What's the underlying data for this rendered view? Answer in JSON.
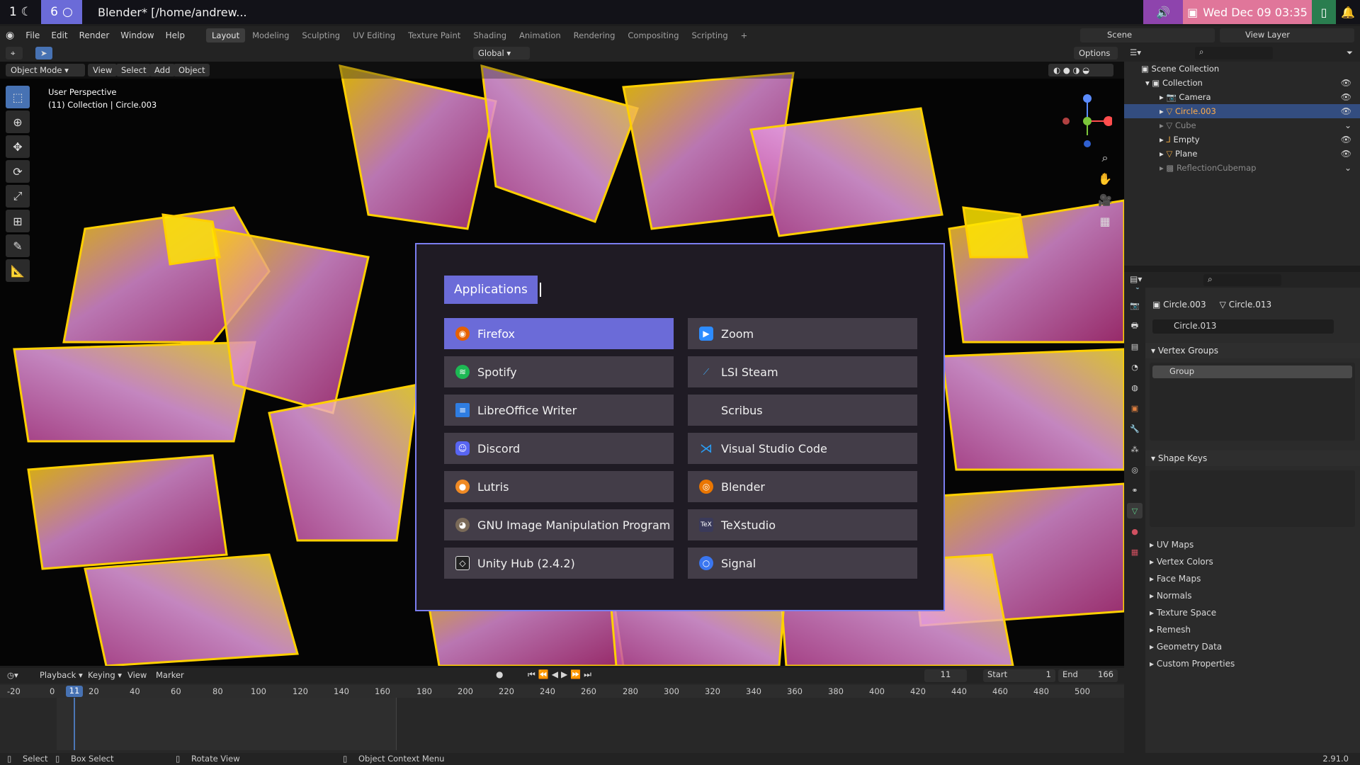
{
  "topbar": {
    "ws1": "1",
    "ws6": "6",
    "window_title": "Blender* [/home/andrew...",
    "clock": "Wed Dec 09 03:35"
  },
  "blender_menu": [
    "File",
    "Edit",
    "Render",
    "Window",
    "Help"
  ],
  "workspaces": [
    "Layout",
    "Modeling",
    "Sculpting",
    "UV Editing",
    "Texture Paint",
    "Shading",
    "Animation",
    "Rendering",
    "Compositing",
    "Scripting"
  ],
  "scene": "Scene",
  "view_layer": "View Layer",
  "viewport": {
    "mode": "Object Mode",
    "menus": [
      "View",
      "Select",
      "Add",
      "Object"
    ],
    "orientation": "Global",
    "options": "Options",
    "info_line1": "User Perspective",
    "info_line2": "(11) Collection | Circle.003"
  },
  "launcher": {
    "prompt": "Applications",
    "entries": [
      {
        "label": "Firefox",
        "icon": "firefox-icon",
        "color": "#e66000"
      },
      {
        "label": "Zoom",
        "icon": "zoom-icon",
        "color": "#2d8cff"
      },
      {
        "label": "Spotify",
        "icon": "spotify-icon",
        "color": "#1db954"
      },
      {
        "label": "LSI Steam",
        "icon": "steam-icon",
        "color": "#3fa9f5"
      },
      {
        "label": "LibreOffice Writer",
        "icon": "writer-icon",
        "color": "#2f7de1"
      },
      {
        "label": "Scribus",
        "icon": "scribus-icon",
        "color": "#433d48"
      },
      {
        "label": "Discord",
        "icon": "discord-icon",
        "color": "#5865f2"
      },
      {
        "label": "Visual Studio Code",
        "icon": "vscode-icon",
        "color": "#2a9df4"
      },
      {
        "label": "Lutris",
        "icon": "lutris-icon",
        "color": "#f08a24"
      },
      {
        "label": "Blender",
        "icon": "blender-icon",
        "color": "#ea7600"
      },
      {
        "label": "GNU Image Manipulation Program",
        "icon": "gimp-icon",
        "color": "#7a6a58"
      },
      {
        "label": "TeXstudio",
        "icon": "texstudio-icon",
        "color": "#3a3a5a"
      },
      {
        "label": "Unity Hub (2.4.2)",
        "icon": "unity-icon",
        "color": "#222"
      },
      {
        "label": "Signal",
        "icon": "signal-icon",
        "color": "#3a76f0"
      }
    ]
  },
  "outliner": {
    "scene_collection": "Scene Collection",
    "collection": "Collection",
    "items": [
      "Camera",
      "Circle.003",
      "Cube",
      "Empty",
      "Plane",
      "ReflectionCubemap"
    ]
  },
  "properties": {
    "object": "Circle.003",
    "mesh": "Circle.013",
    "mesh_field": "Circle.013",
    "vertex_groups": "Vertex Groups",
    "group": "Group",
    "shape_keys": "Shape Keys",
    "sections": [
      "UV Maps",
      "Vertex Colors",
      "Face Maps",
      "Normals",
      "Texture Space",
      "Remesh",
      "Geometry Data",
      "Custom Properties"
    ]
  },
  "timeline": {
    "menus": [
      "Playback",
      "Keying",
      "View",
      "Marker"
    ],
    "current_frame": "11",
    "start_label": "Start",
    "start": "1",
    "end_label": "End",
    "end": "166",
    "ticks": [
      "-20",
      "0",
      "20",
      "40",
      "60",
      "80",
      "100",
      "120",
      "140",
      "160",
      "180",
      "200",
      "220",
      "240",
      "260",
      "280",
      "300",
      "320",
      "340",
      "360",
      "380",
      "400",
      "420",
      "440",
      "460",
      "480",
      "500"
    ]
  },
  "statusbar": {
    "select": "Select",
    "box_select": "Box Select",
    "rotate": "Rotate View",
    "context": "Object Context Menu",
    "version": "2.91.0"
  }
}
